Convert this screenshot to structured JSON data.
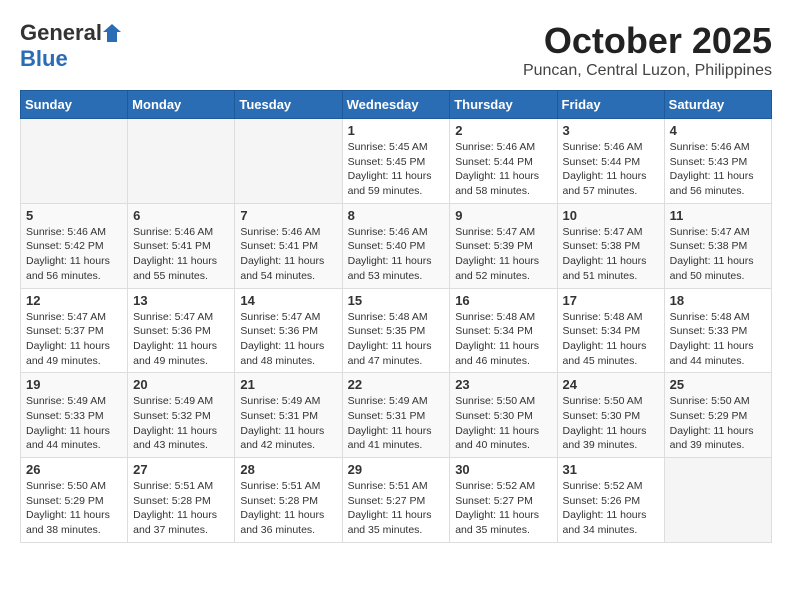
{
  "logo": {
    "general": "General",
    "blue": "Blue"
  },
  "header": {
    "month": "October 2025",
    "location": "Puncan, Central Luzon, Philippines"
  },
  "weekdays": [
    "Sunday",
    "Monday",
    "Tuesday",
    "Wednesday",
    "Thursday",
    "Friday",
    "Saturday"
  ],
  "weeks": [
    [
      {
        "day": "",
        "sunrise": "",
        "sunset": "",
        "daylight": ""
      },
      {
        "day": "",
        "sunrise": "",
        "sunset": "",
        "daylight": ""
      },
      {
        "day": "",
        "sunrise": "",
        "sunset": "",
        "daylight": ""
      },
      {
        "day": "1",
        "sunrise": "Sunrise: 5:45 AM",
        "sunset": "Sunset: 5:45 PM",
        "daylight": "Daylight: 11 hours and 59 minutes."
      },
      {
        "day": "2",
        "sunrise": "Sunrise: 5:46 AM",
        "sunset": "Sunset: 5:44 PM",
        "daylight": "Daylight: 11 hours and 58 minutes."
      },
      {
        "day": "3",
        "sunrise": "Sunrise: 5:46 AM",
        "sunset": "Sunset: 5:44 PM",
        "daylight": "Daylight: 11 hours and 57 minutes."
      },
      {
        "day": "4",
        "sunrise": "Sunrise: 5:46 AM",
        "sunset": "Sunset: 5:43 PM",
        "daylight": "Daylight: 11 hours and 56 minutes."
      }
    ],
    [
      {
        "day": "5",
        "sunrise": "Sunrise: 5:46 AM",
        "sunset": "Sunset: 5:42 PM",
        "daylight": "Daylight: 11 hours and 56 minutes."
      },
      {
        "day": "6",
        "sunrise": "Sunrise: 5:46 AM",
        "sunset": "Sunset: 5:41 PM",
        "daylight": "Daylight: 11 hours and 55 minutes."
      },
      {
        "day": "7",
        "sunrise": "Sunrise: 5:46 AM",
        "sunset": "Sunset: 5:41 PM",
        "daylight": "Daylight: 11 hours and 54 minutes."
      },
      {
        "day": "8",
        "sunrise": "Sunrise: 5:46 AM",
        "sunset": "Sunset: 5:40 PM",
        "daylight": "Daylight: 11 hours and 53 minutes."
      },
      {
        "day": "9",
        "sunrise": "Sunrise: 5:47 AM",
        "sunset": "Sunset: 5:39 PM",
        "daylight": "Daylight: 11 hours and 52 minutes."
      },
      {
        "day": "10",
        "sunrise": "Sunrise: 5:47 AM",
        "sunset": "Sunset: 5:38 PM",
        "daylight": "Daylight: 11 hours and 51 minutes."
      },
      {
        "day": "11",
        "sunrise": "Sunrise: 5:47 AM",
        "sunset": "Sunset: 5:38 PM",
        "daylight": "Daylight: 11 hours and 50 minutes."
      }
    ],
    [
      {
        "day": "12",
        "sunrise": "Sunrise: 5:47 AM",
        "sunset": "Sunset: 5:37 PM",
        "daylight": "Daylight: 11 hours and 49 minutes."
      },
      {
        "day": "13",
        "sunrise": "Sunrise: 5:47 AM",
        "sunset": "Sunset: 5:36 PM",
        "daylight": "Daylight: 11 hours and 49 minutes."
      },
      {
        "day": "14",
        "sunrise": "Sunrise: 5:47 AM",
        "sunset": "Sunset: 5:36 PM",
        "daylight": "Daylight: 11 hours and 48 minutes."
      },
      {
        "day": "15",
        "sunrise": "Sunrise: 5:48 AM",
        "sunset": "Sunset: 5:35 PM",
        "daylight": "Daylight: 11 hours and 47 minutes."
      },
      {
        "day": "16",
        "sunrise": "Sunrise: 5:48 AM",
        "sunset": "Sunset: 5:34 PM",
        "daylight": "Daylight: 11 hours and 46 minutes."
      },
      {
        "day": "17",
        "sunrise": "Sunrise: 5:48 AM",
        "sunset": "Sunset: 5:34 PM",
        "daylight": "Daylight: 11 hours and 45 minutes."
      },
      {
        "day": "18",
        "sunrise": "Sunrise: 5:48 AM",
        "sunset": "Sunset: 5:33 PM",
        "daylight": "Daylight: 11 hours and 44 minutes."
      }
    ],
    [
      {
        "day": "19",
        "sunrise": "Sunrise: 5:49 AM",
        "sunset": "Sunset: 5:33 PM",
        "daylight": "Daylight: 11 hours and 44 minutes."
      },
      {
        "day": "20",
        "sunrise": "Sunrise: 5:49 AM",
        "sunset": "Sunset: 5:32 PM",
        "daylight": "Daylight: 11 hours and 43 minutes."
      },
      {
        "day": "21",
        "sunrise": "Sunrise: 5:49 AM",
        "sunset": "Sunset: 5:31 PM",
        "daylight": "Daylight: 11 hours and 42 minutes."
      },
      {
        "day": "22",
        "sunrise": "Sunrise: 5:49 AM",
        "sunset": "Sunset: 5:31 PM",
        "daylight": "Daylight: 11 hours and 41 minutes."
      },
      {
        "day": "23",
        "sunrise": "Sunrise: 5:50 AM",
        "sunset": "Sunset: 5:30 PM",
        "daylight": "Daylight: 11 hours and 40 minutes."
      },
      {
        "day": "24",
        "sunrise": "Sunrise: 5:50 AM",
        "sunset": "Sunset: 5:30 PM",
        "daylight": "Daylight: 11 hours and 39 minutes."
      },
      {
        "day": "25",
        "sunrise": "Sunrise: 5:50 AM",
        "sunset": "Sunset: 5:29 PM",
        "daylight": "Daylight: 11 hours and 39 minutes."
      }
    ],
    [
      {
        "day": "26",
        "sunrise": "Sunrise: 5:50 AM",
        "sunset": "Sunset: 5:29 PM",
        "daylight": "Daylight: 11 hours and 38 minutes."
      },
      {
        "day": "27",
        "sunrise": "Sunrise: 5:51 AM",
        "sunset": "Sunset: 5:28 PM",
        "daylight": "Daylight: 11 hours and 37 minutes."
      },
      {
        "day": "28",
        "sunrise": "Sunrise: 5:51 AM",
        "sunset": "Sunset: 5:28 PM",
        "daylight": "Daylight: 11 hours and 36 minutes."
      },
      {
        "day": "29",
        "sunrise": "Sunrise: 5:51 AM",
        "sunset": "Sunset: 5:27 PM",
        "daylight": "Daylight: 11 hours and 35 minutes."
      },
      {
        "day": "30",
        "sunrise": "Sunrise: 5:52 AM",
        "sunset": "Sunset: 5:27 PM",
        "daylight": "Daylight: 11 hours and 35 minutes."
      },
      {
        "day": "31",
        "sunrise": "Sunrise: 5:52 AM",
        "sunset": "Sunset: 5:26 PM",
        "daylight": "Daylight: 11 hours and 34 minutes."
      },
      {
        "day": "",
        "sunrise": "",
        "sunset": "",
        "daylight": ""
      }
    ]
  ]
}
